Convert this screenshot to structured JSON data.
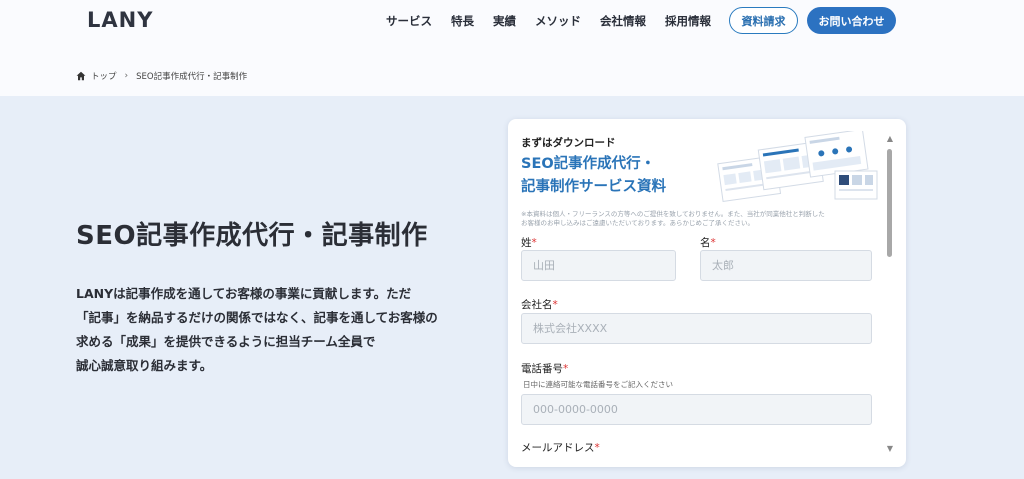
{
  "header": {
    "logo": "LANY",
    "nav": [
      "サービス",
      "特長",
      "実績",
      "メソッド",
      "会社情報",
      "採用情報"
    ],
    "download_button": "資料請求",
    "contact_button": "お問い合わせ"
  },
  "breadcrumb": {
    "home": "トップ",
    "current": "SEO記事作成代行・記事制作"
  },
  "hero": {
    "title": "SEO記事作成代行・記事制作",
    "desc_lines": [
      "LANYは記事作成を通してお客様の事業に貢献します。ただ",
      "「記事」を納品するだけの関係ではなく、記事を通してお客様の",
      "求める「成果」を提供できるように担当チーム全員で",
      "誠心誠意取り組みます。"
    ]
  },
  "form": {
    "kicker": "まずはダウンロード",
    "title_lines": [
      "SEO記事作成代行・",
      "記事制作サービス資料"
    ],
    "notice_lines": [
      "※本資料は個人・フリーランスの方等へのご提供を致しておりません。また、当社が同業他社と判断した",
      "お客様のお申し込みはご遠慮いただいております。あらかじめご了承ください。"
    ],
    "last_name_label": "姓",
    "last_name_placeholder": "山田",
    "first_name_label": "名",
    "first_name_placeholder": "太郎",
    "company_label": "会社名",
    "company_placeholder": "株式会社XXXX",
    "phone_label": "電話番号",
    "phone_hint": "日中に連絡可能な電話番号をご記入ください",
    "phone_placeholder": "000-0000-0000",
    "email_label": "メールアドレス",
    "required_mark": "*"
  },
  "colors": {
    "accent": "#2c72c1",
    "hero_bg": "#e7eef8",
    "title_blue": "#2a74b8",
    "required": "#dd3333"
  }
}
